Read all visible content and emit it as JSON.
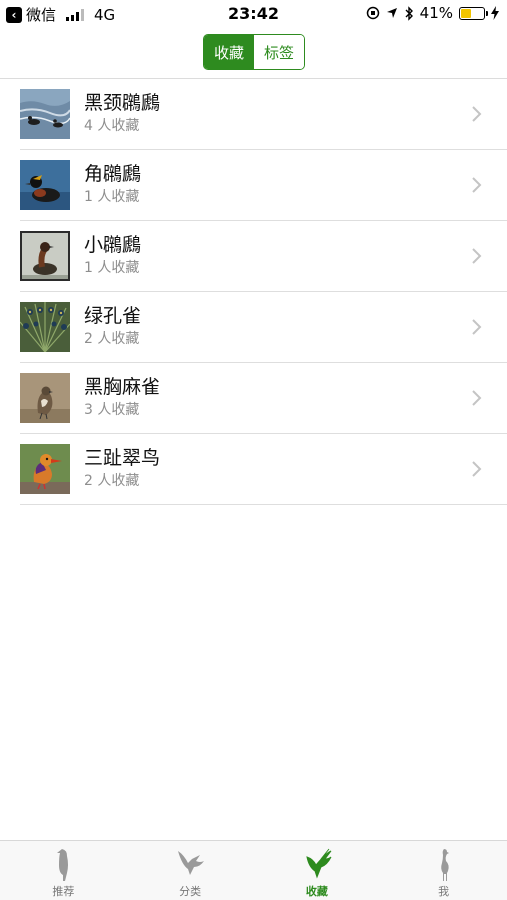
{
  "status_bar": {
    "back_label": "微信",
    "network": "4G",
    "time": "23:42",
    "battery": "41%",
    "battery_level": 0.41
  },
  "segment": {
    "items": [
      {
        "label": "收藏",
        "active": true
      },
      {
        "label": "标签",
        "active": false
      }
    ]
  },
  "list": {
    "items": [
      {
        "name": "黑颈鸊鷉",
        "count": "4 人收藏"
      },
      {
        "name": "角鸊鷉",
        "count": "1 人收藏"
      },
      {
        "name": "小鸊鷉",
        "count": "1 人收藏"
      },
      {
        "name": "绿孔雀",
        "count": "2 人收藏"
      },
      {
        "name": "黑胸麻雀",
        "count": "3 人收藏"
      },
      {
        "name": "三趾翠鸟",
        "count": "2 人收藏"
      }
    ]
  },
  "tabbar": {
    "tabs": [
      {
        "label": "推荐",
        "icon": "bird-perched-icon",
        "active": false
      },
      {
        "label": "分类",
        "icon": "bird-flying-icon",
        "active": false
      },
      {
        "label": "收藏",
        "icon": "hummingbird-icon",
        "active": true
      },
      {
        "label": "我",
        "icon": "heron-icon",
        "active": false
      }
    ]
  },
  "colors": {
    "accent": "#2e8b1f",
    "inactive_icon": "#9a9a9a",
    "secondary_text": "#8e8e8e"
  }
}
